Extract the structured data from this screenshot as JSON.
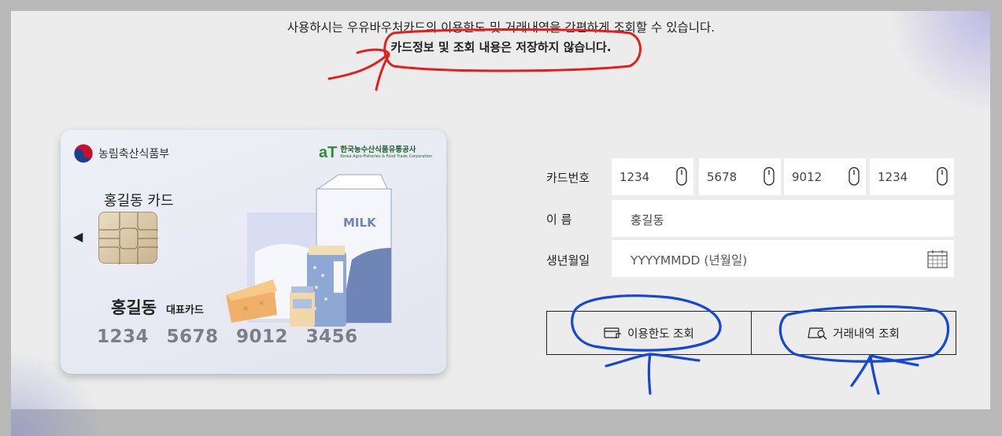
{
  "intro": {
    "line1": "사용하시는 우유바우처카드의 이용한도 및 거래내역을 간편하게 조회할 수 있습니다.",
    "line2": "카드정보 및 조회 내용은 저장하지 않습니다."
  },
  "card": {
    "ministry_name": "농림축산식품부",
    "agency_mark": "aT",
    "agency_name_ko": "한국농수산식품유통공사",
    "agency_name_en": "Korea Agro-Fisheries & Food Trade Corporation",
    "title": "홍길동 카드",
    "holder_name": "홍길동",
    "holder_tag": "대표카드",
    "number": "1234 5678 9012 3456",
    "milk_label": "MILK"
  },
  "form": {
    "card_number_label": "카드번호",
    "card_number_parts": [
      "1234",
      "5678",
      "9012",
      "1234"
    ],
    "name_label": "이 름",
    "name_value": "홍길동",
    "birth_label": "생년월일",
    "birth_placeholder": "YYYYMMDD (년월일)"
  },
  "buttons": {
    "limit_label": "이용한도 조회",
    "history_label": "거래내역 조회"
  },
  "colors": {
    "annotation_red": "#e0201c",
    "annotation_blue": "#1446d8"
  }
}
